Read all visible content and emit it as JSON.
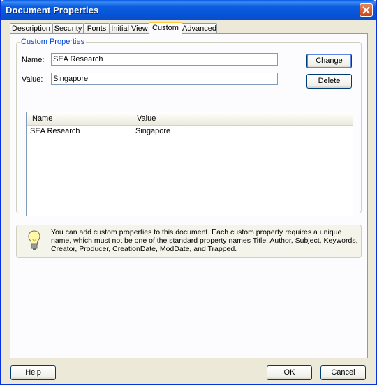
{
  "window": {
    "title": "Document Properties"
  },
  "tabs": [
    {
      "label": "Description"
    },
    {
      "label": "Security"
    },
    {
      "label": "Fonts"
    },
    {
      "label": "Initial View"
    },
    {
      "label": "Custom",
      "active": true
    },
    {
      "label": "Advanced"
    }
  ],
  "custom": {
    "group_title": "Custom Properties",
    "name_label": "Name:",
    "name_value": "SEA Research",
    "value_label": "Value:",
    "value_value": "Singapore",
    "change_label": "Change",
    "delete_label": "Delete",
    "columns": [
      "Name",
      "Value"
    ],
    "rows": [
      {
        "name": "SEA Research",
        "value": "Singapore"
      }
    ]
  },
  "info": {
    "icon": "lightbulb-icon",
    "text": "You can add custom properties to this document. Each custom property requires a unique name, which must not be one of the standard property names Title, Author, Subject, Keywords, Creator, Producer, CreationDate, ModDate, and Trapped."
  },
  "buttons": {
    "help": "Help",
    "ok": "OK",
    "cancel": "Cancel"
  },
  "colors": {
    "titlebar": "#0654d8",
    "tab_highlight": "#ffc83c",
    "group_title": "#0046d5",
    "close": "#cc4419"
  }
}
